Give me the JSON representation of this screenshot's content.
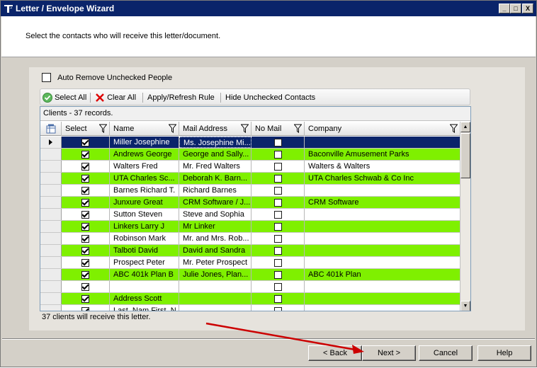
{
  "window": {
    "title": "Letter / Envelope Wizard",
    "minimize_glyph": "_",
    "maximize_glyph": "□",
    "close_glyph": "X"
  },
  "header": {
    "instruction": "Select the contacts who will receive this letter/document."
  },
  "options": {
    "auto_remove_label": "Auto Remove Unchecked People",
    "auto_remove_checked": false
  },
  "toolbar": {
    "select_all": "Select All",
    "clear_all": "Clear All",
    "apply_refresh": "Apply/Refresh Rule",
    "hide_unchecked": "Hide Unchecked Contacts"
  },
  "grid": {
    "caption": "Clients - 37 records.",
    "columns": [
      "Select",
      "Name",
      "Mail Address",
      "No Mail",
      "Company"
    ],
    "rows": [
      {
        "select": true,
        "name": "Miller Josephine",
        "mail": "Ms. Josephine Mi...",
        "nomail": false,
        "company": "",
        "style": "sel",
        "current": true
      },
      {
        "select": true,
        "name": "Andrews George",
        "mail": "George and Sally...",
        "nomail": false,
        "company": "Baconville Amusement Parks",
        "style": "green"
      },
      {
        "select": true,
        "name": "Walters Fred",
        "mail": "Mr. Fred Walters",
        "nomail": false,
        "company": "Walters & Walters",
        "style": "white"
      },
      {
        "select": true,
        "name": "UTA Charles Sc...",
        "mail": "Deborah K. Barn...",
        "nomail": false,
        "company": "UTA Charles Schwab & Co Inc",
        "style": "green"
      },
      {
        "select": true,
        "name": "Barnes Richard T.",
        "mail": "Richard Barnes",
        "nomail": false,
        "company": "",
        "style": "white"
      },
      {
        "select": true,
        "name": "Junxure Great",
        "mail": "CRM Software / J...",
        "nomail": false,
        "company": "CRM Software",
        "style": "green"
      },
      {
        "select": true,
        "name": "Sutton Steven",
        "mail": "Steve and Sophia",
        "nomail": false,
        "company": "",
        "style": "white"
      },
      {
        "select": true,
        "name": "Linkers Larry J",
        "mail": "Mr Linker",
        "nomail": false,
        "company": "",
        "style": "green"
      },
      {
        "select": true,
        "name": "Robinson Mark",
        "mail": "Mr. and Mrs. Rob...",
        "nomail": false,
        "company": "",
        "style": "white"
      },
      {
        "select": true,
        "name": "Talboti David",
        "mail": "David and Sandra",
        "nomail": false,
        "company": "",
        "style": "green"
      },
      {
        "select": true,
        "name": "Prospect Peter",
        "mail": "Mr. Peter Prospect",
        "nomail": false,
        "company": "",
        "style": "white"
      },
      {
        "select": true,
        "name": "ABC 401k Plan B",
        "mail": "Julie Jones, Plan...",
        "nomail": false,
        "company": "ABC 401k Plan",
        "style": "green"
      },
      {
        "select": true,
        "name": "",
        "mail": "",
        "nomail": false,
        "company": "",
        "style": "white"
      },
      {
        "select": true,
        "name": "Address Scott",
        "mail": "",
        "nomail": false,
        "company": "",
        "style": "green"
      },
      {
        "select": true,
        "name": "Last_Nam First_N...",
        "mail": "",
        "nomail": false,
        "company": "",
        "style": "white"
      }
    ]
  },
  "status_text": "37 clients will receive this letter.",
  "buttons": {
    "back": "< Back",
    "next": "Next >",
    "cancel": "Cancel",
    "help": "Help"
  },
  "colors": {
    "titlebar": "#0a246a",
    "row_highlight": "#7ff000",
    "arrow": "#cc0000"
  }
}
